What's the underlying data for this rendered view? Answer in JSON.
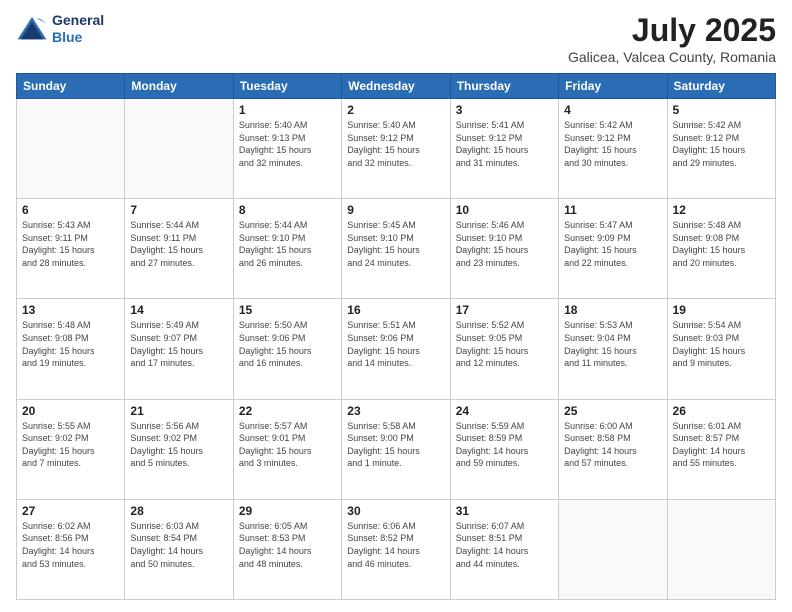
{
  "header": {
    "logo_line1": "General",
    "logo_line2": "Blue",
    "month": "July 2025",
    "location": "Galicea, Valcea County, Romania"
  },
  "days_of_week": [
    "Sunday",
    "Monday",
    "Tuesday",
    "Wednesday",
    "Thursday",
    "Friday",
    "Saturday"
  ],
  "weeks": [
    [
      {
        "num": "",
        "detail": ""
      },
      {
        "num": "",
        "detail": ""
      },
      {
        "num": "1",
        "detail": "Sunrise: 5:40 AM\nSunset: 9:13 PM\nDaylight: 15 hours\nand 32 minutes."
      },
      {
        "num": "2",
        "detail": "Sunrise: 5:40 AM\nSunset: 9:12 PM\nDaylight: 15 hours\nand 32 minutes."
      },
      {
        "num": "3",
        "detail": "Sunrise: 5:41 AM\nSunset: 9:12 PM\nDaylight: 15 hours\nand 31 minutes."
      },
      {
        "num": "4",
        "detail": "Sunrise: 5:42 AM\nSunset: 9:12 PM\nDaylight: 15 hours\nand 30 minutes."
      },
      {
        "num": "5",
        "detail": "Sunrise: 5:42 AM\nSunset: 9:12 PM\nDaylight: 15 hours\nand 29 minutes."
      }
    ],
    [
      {
        "num": "6",
        "detail": "Sunrise: 5:43 AM\nSunset: 9:11 PM\nDaylight: 15 hours\nand 28 minutes."
      },
      {
        "num": "7",
        "detail": "Sunrise: 5:44 AM\nSunset: 9:11 PM\nDaylight: 15 hours\nand 27 minutes."
      },
      {
        "num": "8",
        "detail": "Sunrise: 5:44 AM\nSunset: 9:10 PM\nDaylight: 15 hours\nand 26 minutes."
      },
      {
        "num": "9",
        "detail": "Sunrise: 5:45 AM\nSunset: 9:10 PM\nDaylight: 15 hours\nand 24 minutes."
      },
      {
        "num": "10",
        "detail": "Sunrise: 5:46 AM\nSunset: 9:10 PM\nDaylight: 15 hours\nand 23 minutes."
      },
      {
        "num": "11",
        "detail": "Sunrise: 5:47 AM\nSunset: 9:09 PM\nDaylight: 15 hours\nand 22 minutes."
      },
      {
        "num": "12",
        "detail": "Sunrise: 5:48 AM\nSunset: 9:08 PM\nDaylight: 15 hours\nand 20 minutes."
      }
    ],
    [
      {
        "num": "13",
        "detail": "Sunrise: 5:48 AM\nSunset: 9:08 PM\nDaylight: 15 hours\nand 19 minutes."
      },
      {
        "num": "14",
        "detail": "Sunrise: 5:49 AM\nSunset: 9:07 PM\nDaylight: 15 hours\nand 17 minutes."
      },
      {
        "num": "15",
        "detail": "Sunrise: 5:50 AM\nSunset: 9:06 PM\nDaylight: 15 hours\nand 16 minutes."
      },
      {
        "num": "16",
        "detail": "Sunrise: 5:51 AM\nSunset: 9:06 PM\nDaylight: 15 hours\nand 14 minutes."
      },
      {
        "num": "17",
        "detail": "Sunrise: 5:52 AM\nSunset: 9:05 PM\nDaylight: 15 hours\nand 12 minutes."
      },
      {
        "num": "18",
        "detail": "Sunrise: 5:53 AM\nSunset: 9:04 PM\nDaylight: 15 hours\nand 11 minutes."
      },
      {
        "num": "19",
        "detail": "Sunrise: 5:54 AM\nSunset: 9:03 PM\nDaylight: 15 hours\nand 9 minutes."
      }
    ],
    [
      {
        "num": "20",
        "detail": "Sunrise: 5:55 AM\nSunset: 9:02 PM\nDaylight: 15 hours\nand 7 minutes."
      },
      {
        "num": "21",
        "detail": "Sunrise: 5:56 AM\nSunset: 9:02 PM\nDaylight: 15 hours\nand 5 minutes."
      },
      {
        "num": "22",
        "detail": "Sunrise: 5:57 AM\nSunset: 9:01 PM\nDaylight: 15 hours\nand 3 minutes."
      },
      {
        "num": "23",
        "detail": "Sunrise: 5:58 AM\nSunset: 9:00 PM\nDaylight: 15 hours\nand 1 minute."
      },
      {
        "num": "24",
        "detail": "Sunrise: 5:59 AM\nSunset: 8:59 PM\nDaylight: 14 hours\nand 59 minutes."
      },
      {
        "num": "25",
        "detail": "Sunrise: 6:00 AM\nSunset: 8:58 PM\nDaylight: 14 hours\nand 57 minutes."
      },
      {
        "num": "26",
        "detail": "Sunrise: 6:01 AM\nSunset: 8:57 PM\nDaylight: 14 hours\nand 55 minutes."
      }
    ],
    [
      {
        "num": "27",
        "detail": "Sunrise: 6:02 AM\nSunset: 8:56 PM\nDaylight: 14 hours\nand 53 minutes."
      },
      {
        "num": "28",
        "detail": "Sunrise: 6:03 AM\nSunset: 8:54 PM\nDaylight: 14 hours\nand 50 minutes."
      },
      {
        "num": "29",
        "detail": "Sunrise: 6:05 AM\nSunset: 8:53 PM\nDaylight: 14 hours\nand 48 minutes."
      },
      {
        "num": "30",
        "detail": "Sunrise: 6:06 AM\nSunset: 8:52 PM\nDaylight: 14 hours\nand 46 minutes."
      },
      {
        "num": "31",
        "detail": "Sunrise: 6:07 AM\nSunset: 8:51 PM\nDaylight: 14 hours\nand 44 minutes."
      },
      {
        "num": "",
        "detail": ""
      },
      {
        "num": "",
        "detail": ""
      }
    ]
  ]
}
